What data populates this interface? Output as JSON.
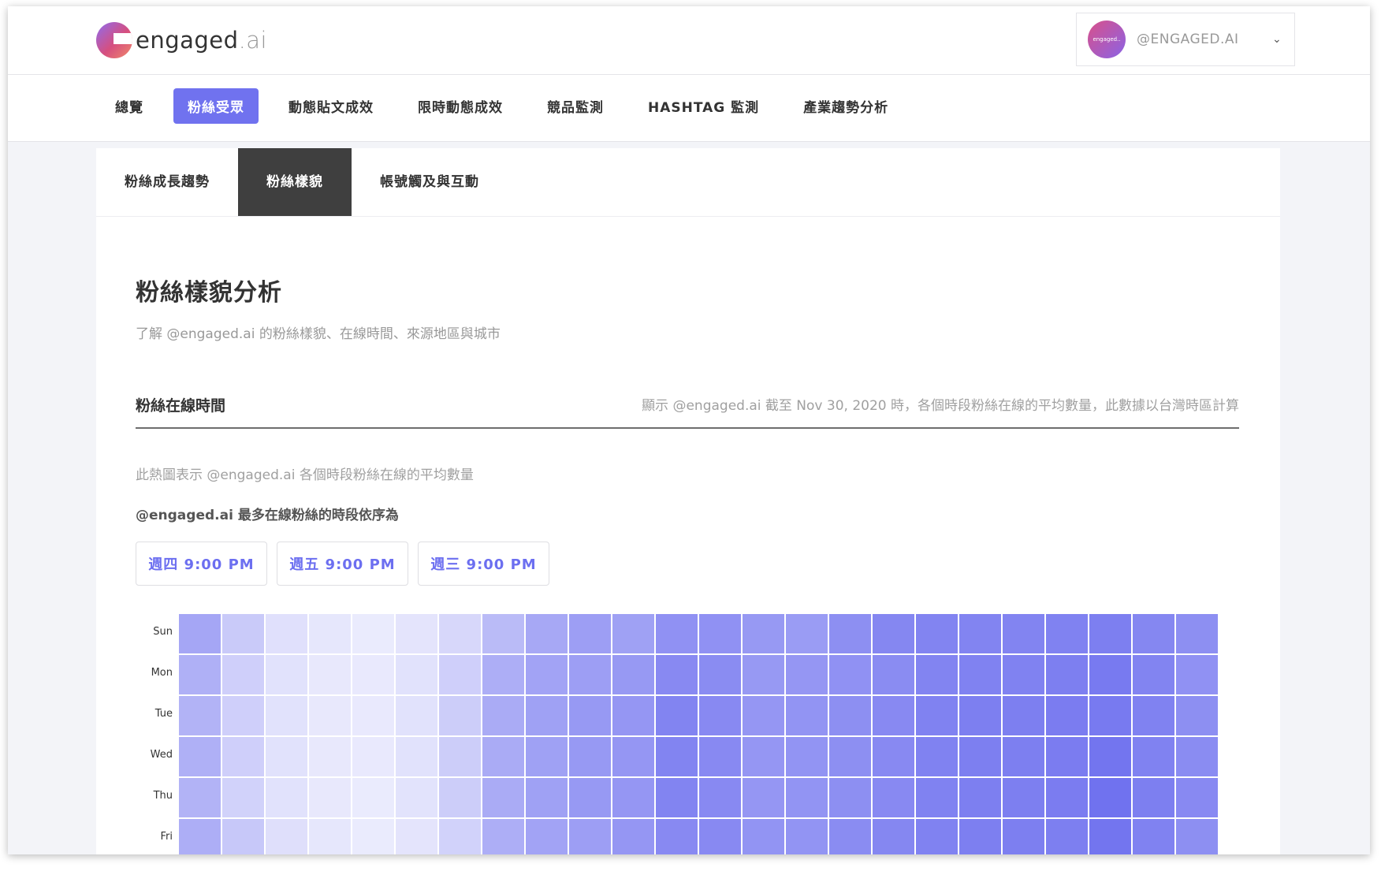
{
  "header": {
    "logo_text": "engaged",
    "logo_suffix": ".ai",
    "account_avatar_text": "engaged..",
    "account_name": "@ENGAGED.AI"
  },
  "main_nav": [
    {
      "label": "總覽",
      "active": false
    },
    {
      "label": "粉絲受眾",
      "active": true
    },
    {
      "label": "動態貼文成效",
      "active": false
    },
    {
      "label": "限時動態成效",
      "active": false
    },
    {
      "label": "競品監測",
      "active": false
    },
    {
      "label": "HASHTAG 監測",
      "active": false
    },
    {
      "label": "產業趨勢分析",
      "active": false
    }
  ],
  "sub_tabs": [
    {
      "label": "粉絲成長趨勢",
      "active": false
    },
    {
      "label": "粉絲樣貌",
      "active": true
    },
    {
      "label": "帳號觸及與互動",
      "active": false
    }
  ],
  "page": {
    "title": "粉絲樣貌分析",
    "subtitle": "了解 @engaged.ai 的粉絲樣貌、在線時間、來源地區與城市"
  },
  "section": {
    "title": "粉絲在線時間",
    "note": "顯示 @engaged.ai 截至 Nov 30, 2020 時，各個時段粉絲在線的平均數量，此數據以台灣時區計算",
    "description": "此熱圖表示 @engaged.ai 各個時段粉絲在線的平均數量",
    "top_label": "@engaged.ai 最多在線粉絲的時段依序為",
    "top_times": [
      "週四 9:00 PM",
      "週五 9:00 PM",
      "週三 9:00 PM"
    ]
  },
  "colors": {
    "accent": "#7072ef",
    "heat_max": "#7072ef"
  },
  "chart_data": {
    "type": "heatmap",
    "rows": [
      "Sun",
      "Mon",
      "Tue",
      "Wed",
      "Thu",
      "Fri"
    ],
    "columns": 24,
    "intensity": [
      [
        0.6,
        0.32,
        0.15,
        0.1,
        0.07,
        0.12,
        0.22,
        0.44,
        0.58,
        0.66,
        0.64,
        0.76,
        0.76,
        0.7,
        0.68,
        0.78,
        0.84,
        0.86,
        0.86,
        0.86,
        0.88,
        0.9,
        0.84,
        0.78
      ],
      [
        0.52,
        0.28,
        0.14,
        0.09,
        0.08,
        0.14,
        0.28,
        0.54,
        0.62,
        0.66,
        0.7,
        0.82,
        0.8,
        0.7,
        0.72,
        0.76,
        0.8,
        0.86,
        0.88,
        0.88,
        0.9,
        0.94,
        0.86,
        0.76
      ],
      [
        0.5,
        0.28,
        0.14,
        0.09,
        0.08,
        0.14,
        0.3,
        0.56,
        0.64,
        0.7,
        0.72,
        0.86,
        0.82,
        0.72,
        0.74,
        0.78,
        0.82,
        0.88,
        0.9,
        0.9,
        0.92,
        0.94,
        0.88,
        0.78
      ],
      [
        0.52,
        0.28,
        0.14,
        0.09,
        0.08,
        0.14,
        0.3,
        0.56,
        0.64,
        0.7,
        0.72,
        0.86,
        0.82,
        0.72,
        0.74,
        0.78,
        0.82,
        0.88,
        0.9,
        0.9,
        0.92,
        0.98,
        0.88,
        0.8
      ],
      [
        0.5,
        0.26,
        0.14,
        0.09,
        0.07,
        0.13,
        0.3,
        0.56,
        0.64,
        0.7,
        0.72,
        0.86,
        0.82,
        0.72,
        0.74,
        0.78,
        0.82,
        0.88,
        0.9,
        0.9,
        0.92,
        1.0,
        0.9,
        0.82
      ],
      [
        0.54,
        0.34,
        0.16,
        0.1,
        0.07,
        0.12,
        0.26,
        0.54,
        0.62,
        0.66,
        0.72,
        0.82,
        0.82,
        0.74,
        0.74,
        0.8,
        0.84,
        0.88,
        0.9,
        0.9,
        0.9,
        0.98,
        0.88,
        0.78
      ]
    ]
  }
}
